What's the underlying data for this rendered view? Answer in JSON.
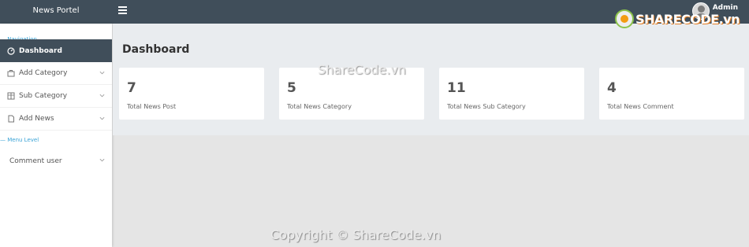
{
  "app": {
    "brand": "News Portel",
    "user_name": "Admin"
  },
  "sidebar": {
    "section_navigation": "Navigation",
    "section_menu_level": "Menu Level",
    "items": [
      {
        "label": "Dashboard",
        "icon": "gauge-icon"
      },
      {
        "label": "Add Category",
        "icon": "briefcase-icon"
      },
      {
        "label": "Sub Category",
        "icon": "columns-icon"
      },
      {
        "label": "Add News",
        "icon": "document-icon"
      },
      {
        "label": "Comment user",
        "icon": ""
      }
    ]
  },
  "main": {
    "title": "Dashboard",
    "cards": [
      {
        "value": "7",
        "label": "Total News Post"
      },
      {
        "value": "5",
        "label": "Total News Category"
      },
      {
        "value": "11",
        "label": "Total News Sub Category"
      },
      {
        "value": "4",
        "label": "Total News Comment"
      }
    ]
  },
  "watermark": {
    "logo_text": "SHARECODE.vn",
    "center_text": "ShareCode.vn",
    "copyright_text": "Copyright © ShareCode.vn"
  },
  "colors": {
    "topbar": "#404e5a",
    "accent": "#3aa3d6"
  }
}
